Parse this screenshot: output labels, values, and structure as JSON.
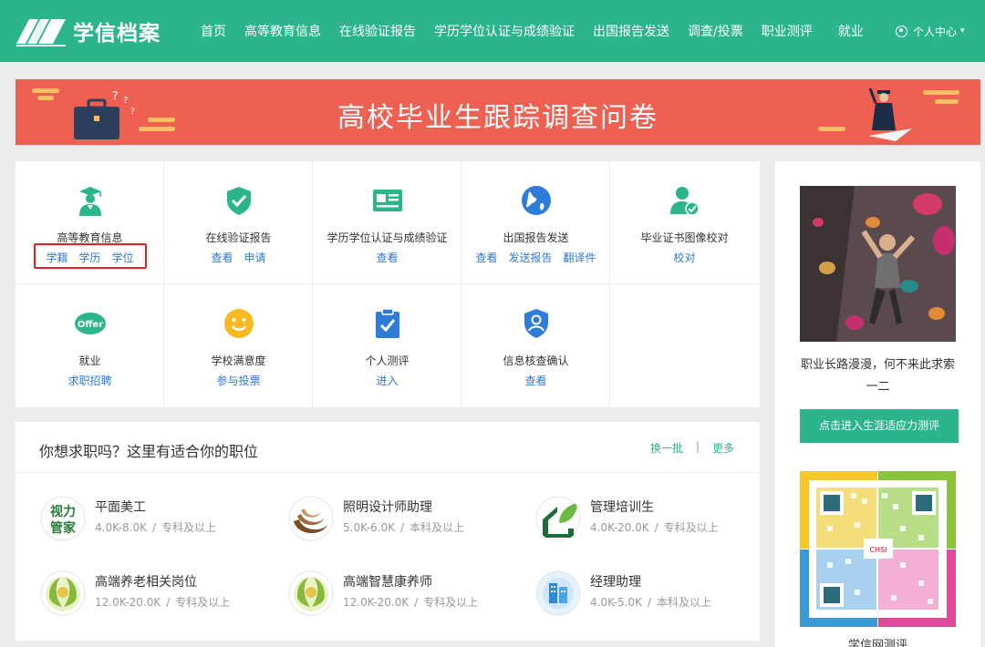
{
  "header": {
    "brand": "学信档案",
    "nav": [
      "首页",
      "高等教育信息",
      "在线验证报告",
      "学历学位认证与成绩验证",
      "出国报告发送",
      "调查/投票",
      "职业测评",
      "就业"
    ],
    "user_center": "个人中心",
    "brand_color": "#2cb48a"
  },
  "banner": {
    "title": "高校毕业生跟踪调查问卷",
    "bg_color": "#ee6152"
  },
  "services": [
    {
      "title": "高等教育信息",
      "links": [
        "学籍",
        "学历",
        "学位"
      ],
      "icon": "graduate-icon",
      "highlighted": true
    },
    {
      "title": "在线验证报告",
      "links": [
        "查看",
        "申请"
      ],
      "icon": "shield-check-icon"
    },
    {
      "title": "学历学位认证与成绩验证",
      "links": [
        "查看"
      ],
      "icon": "id-card-icon"
    },
    {
      "title": "出国报告发送",
      "links": [
        "查看",
        "发送报告",
        "翻译件"
      ],
      "icon": "globe-icon"
    },
    {
      "title": "毕业证书图像校对",
      "links": [
        "校对"
      ],
      "icon": "user-check-icon"
    },
    {
      "title": "就业",
      "links": [
        "求职招聘"
      ],
      "icon": "offer-icon",
      "icon_text": "Offer"
    },
    {
      "title": "学校满意度",
      "links": [
        "参与投票"
      ],
      "icon": "smile-icon"
    },
    {
      "title": "个人测评",
      "links": [
        "进入"
      ],
      "icon": "clipboard-check-icon"
    },
    {
      "title": "信息核查确认",
      "links": [
        "查看"
      ],
      "icon": "shield-user-icon"
    }
  ],
  "jobs": {
    "title": "你想求职吗？这里有适合你的职位",
    "refresh": "换一批",
    "more": "更多",
    "list": [
      {
        "name": "平面美工",
        "salary": "4.0K-8.0K",
        "edu": "专科及以上",
        "logo": "shili-logo",
        "logo_text": [
          "视力",
          "管家"
        ]
      },
      {
        "name": "照明设计师助理",
        "salary": "5.0K-6.0K",
        "edu": "本科及以上",
        "logo": "swirl-logo"
      },
      {
        "name": "管理培训生",
        "salary": "4.0K-20.0K",
        "edu": "专科及以上",
        "logo": "house-leaf-logo"
      },
      {
        "name": "高端养老相关岗位",
        "salary": "12.0K-20.0K",
        "edu": "专科及以上",
        "logo": "wreath-logo"
      },
      {
        "name": "高端智慧康养师",
        "salary": "12.0K-20.0K",
        "edu": "专科及以上",
        "logo": "wreath-logo"
      },
      {
        "name": "经理助理",
        "salary": "4.0K-5.0K",
        "edu": "本科及以上",
        "logo": "building-logo"
      }
    ]
  },
  "sidebar": {
    "caption": "职业长路漫漫，何不来此求索一二",
    "button": "点击进入生涯适应力测评",
    "qr_label": "学信网测评",
    "qr_logo_text": "CHSI"
  }
}
